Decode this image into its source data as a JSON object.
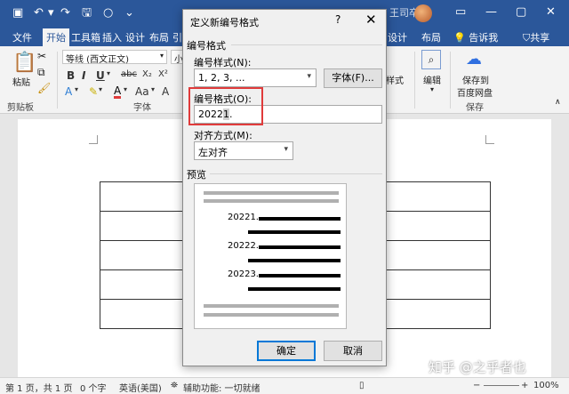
{
  "window": {
    "title_partial": "...",
    "user_partial": "王司卒"
  },
  "tabs": [
    {
      "label": "文件"
    },
    {
      "label": "开始"
    },
    {
      "label": "工具箱"
    },
    {
      "label": "插入"
    },
    {
      "label": "设计"
    },
    {
      "label": "布局"
    },
    {
      "label": "引"
    },
    {
      "label": "设计"
    },
    {
      "label": "布局"
    }
  ],
  "tell_me": "告诉我",
  "share": "共享",
  "ribbon": {
    "paste": "粘贴",
    "clipboard": "剪贴板",
    "font_name": "等线 (西文正文)",
    "font_size_partial": "小",
    "font_group": "字体",
    "styles_partial": "样式",
    "edit": "编辑",
    "save_to": "保存到",
    "baidu_disk": "百度网盘",
    "save_group": "保存"
  },
  "dialog": {
    "title": "定义新编号格式",
    "help": "?",
    "section_number_format": "编号格式",
    "number_style_label": "编号样式(N):",
    "number_style_value": "1, 2, 3, ...",
    "font_button": "字体(F)...",
    "number_format_label": "编号格式(O):",
    "number_format_value_prefix": "2022",
    "number_format_value_num": "1",
    "number_format_value_suffix": ".",
    "alignment_label": "对齐方式(M):",
    "alignment_value": "左对齐",
    "preview_label": "预览",
    "preview_items": [
      "20221.",
      "20222.",
      "20223."
    ],
    "ok": "确定",
    "cancel": "取消"
  },
  "status": {
    "page": "第 1 页，共 1 页",
    "words": "0 个字",
    "language": "英语(美国)",
    "accessibility": "辅助功能: 一切就绪",
    "zoom": "100%"
  },
  "watermark": "知乎 @之乎者也",
  "colors": {
    "word_blue": "#2b579a",
    "highlight_red": "#e03b3b",
    "ok_border": "#0078d7"
  }
}
